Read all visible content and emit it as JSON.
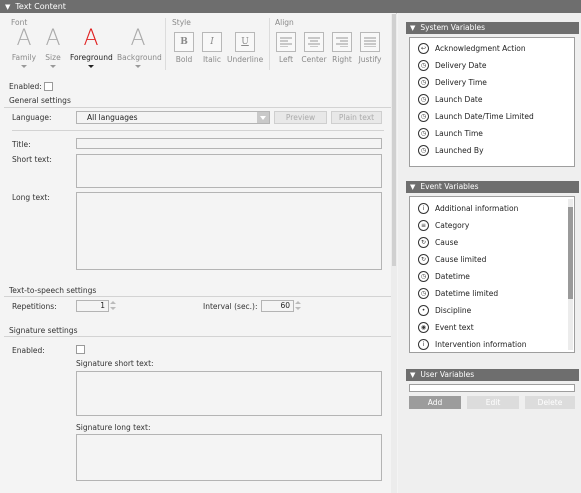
{
  "header": {
    "title": "Text Content"
  },
  "toolbar": {
    "font_group": "Font",
    "style_group": "Style",
    "align_group": "Align",
    "family_label": "Family",
    "size_label": "Size",
    "foreground_label": "Foreground",
    "background_label": "Background",
    "bold_label": "Bold",
    "italic_label": "Italic",
    "underline_label": "Underline",
    "left_label": "Left",
    "center_label": "Center",
    "right_label": "Right",
    "justify_label": "Justify",
    "foreground_color": "#e02020"
  },
  "enabled": {
    "label": "Enabled:",
    "checked": false
  },
  "general": {
    "heading": "General settings",
    "language_label": "Language:",
    "language_value": "All languages",
    "preview_label": "Preview",
    "plain_text_label": "Plain text",
    "title_label": "Title:",
    "short_text_label": "Short text:",
    "long_text_label": "Long text:"
  },
  "tts": {
    "heading": "Text-to-speech settings",
    "repetitions_label": "Repetitions:",
    "repetitions_value": "1",
    "interval_label": "Interval (sec.):",
    "interval_value": "60"
  },
  "signature": {
    "heading": "Signature settings",
    "enabled_label": "Enabled:",
    "short_text_label": "Signature short text:",
    "long_text_label": "Signature long text:"
  },
  "system_variables": {
    "title": "System Variables",
    "items": [
      {
        "label": "Acknowledgment Action",
        "icon": "ack-icon"
      },
      {
        "label": "Delivery Date",
        "icon": "date-icon"
      },
      {
        "label": "Delivery Time",
        "icon": "time-icon"
      },
      {
        "label": "Launch Date",
        "icon": "date-icon"
      },
      {
        "label": "Launch Date/Time Limited",
        "icon": "date-icon"
      },
      {
        "label": "Launch Time",
        "icon": "time-icon"
      },
      {
        "label": "Launched By",
        "icon": "user-icon"
      }
    ]
  },
  "event_variables": {
    "title": "Event Variables",
    "items": [
      {
        "label": "Additional information",
        "icon": "info-icon"
      },
      {
        "label": "Category",
        "icon": "list-icon"
      },
      {
        "label": "Cause",
        "icon": "cause-icon"
      },
      {
        "label": "Cause limited",
        "icon": "cause-icon"
      },
      {
        "label": "Datetime",
        "icon": "date-icon"
      },
      {
        "label": "Datetime limited",
        "icon": "date-icon"
      },
      {
        "label": "Discipline",
        "icon": "dot-icon"
      },
      {
        "label": "Event text",
        "icon": "text-icon"
      },
      {
        "label": "Intervention information",
        "icon": "info-icon"
      }
    ]
  },
  "user_variables": {
    "title": "User Variables",
    "add_label": "Add",
    "edit_label": "Edit",
    "delete_label": "Delete"
  }
}
